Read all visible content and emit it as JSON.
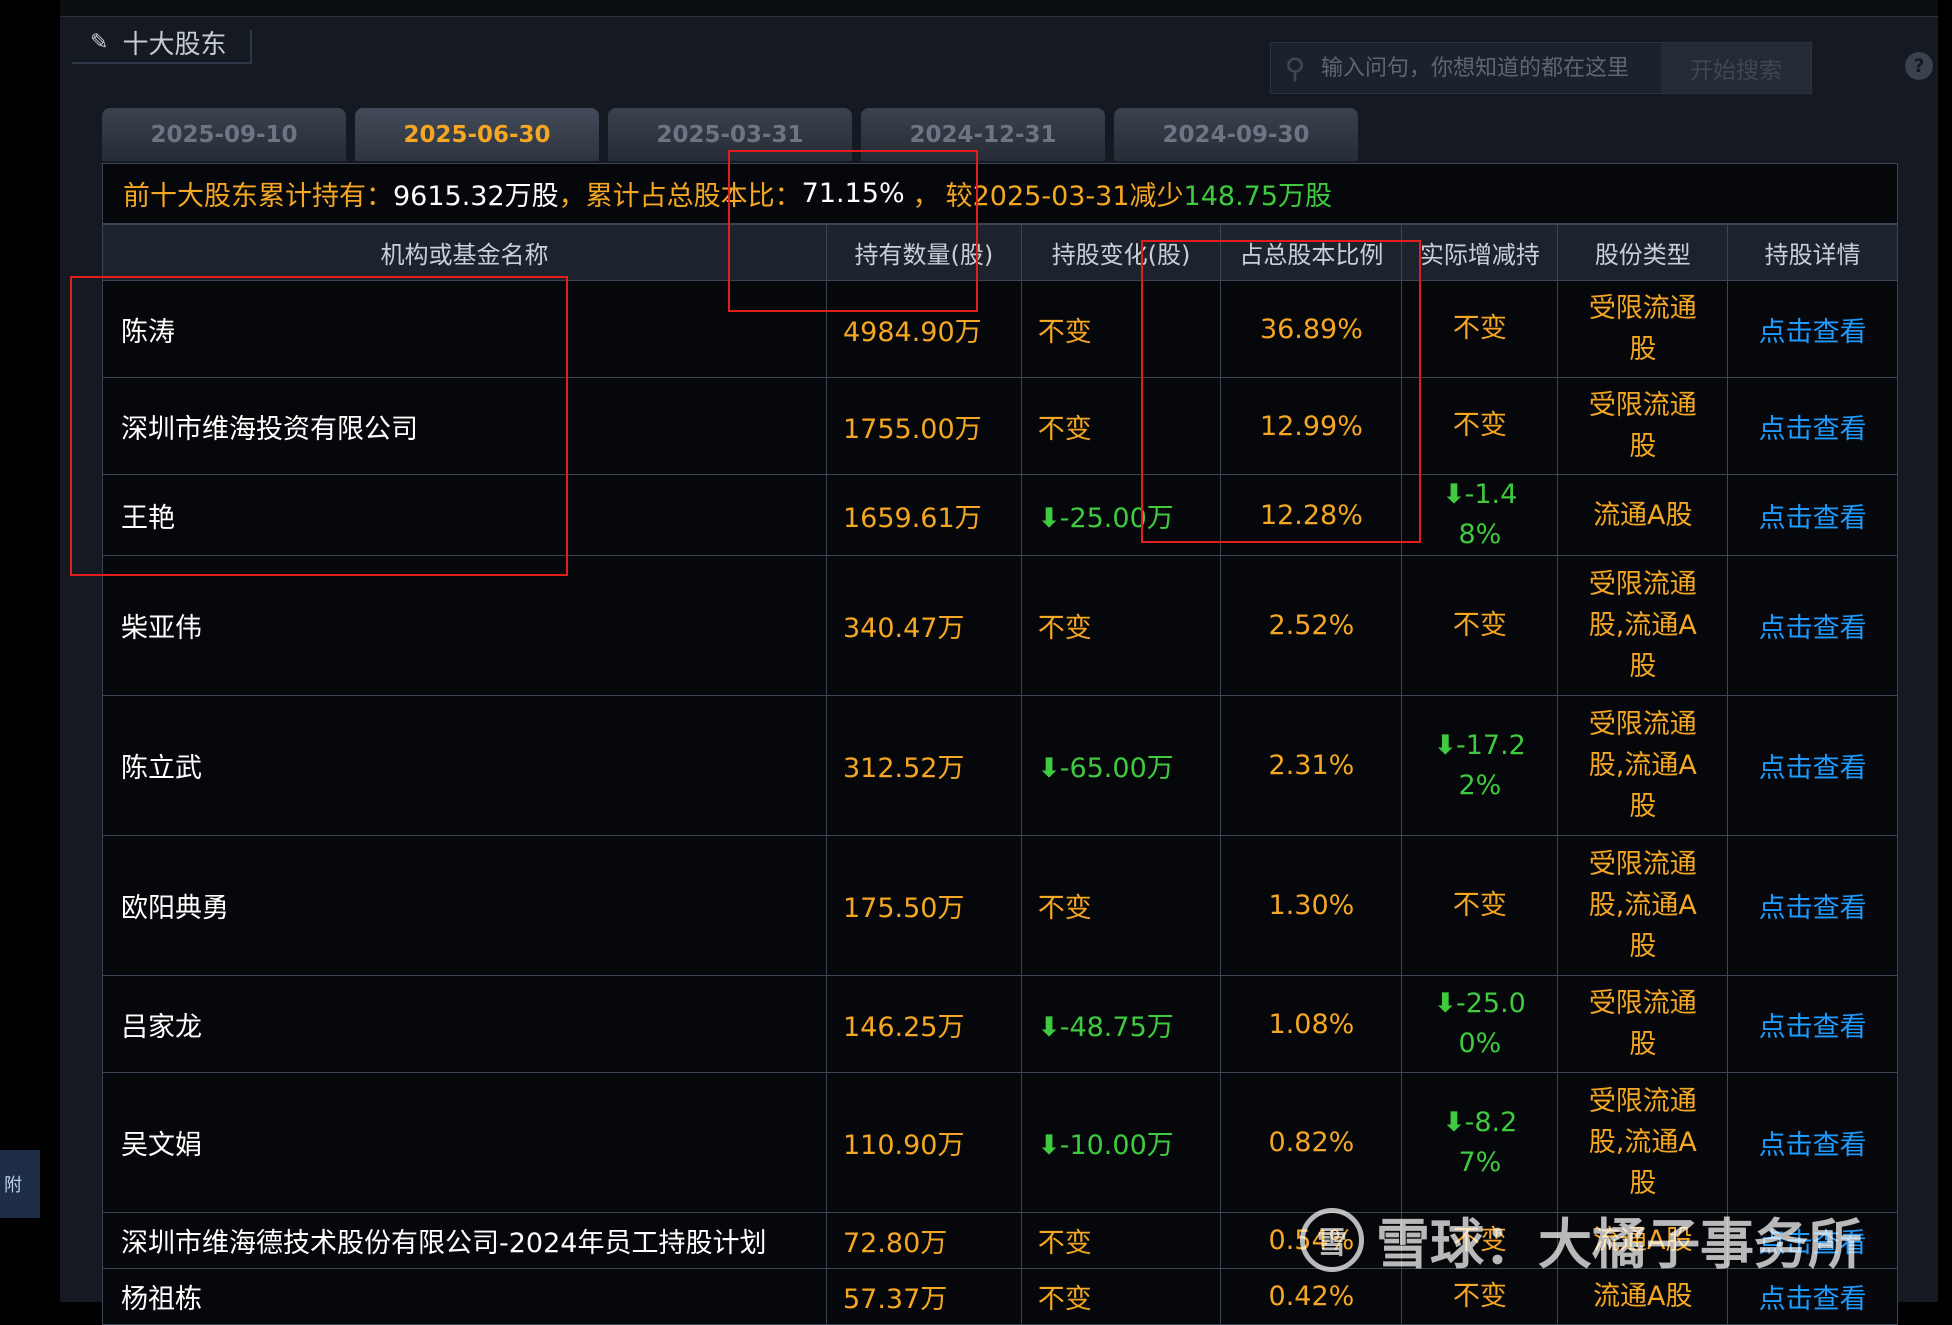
{
  "header": {
    "section_title": "十大股东",
    "search_placeholder": "输入问句，你想知道的都在这里",
    "search_button": "开始搜索",
    "help_icon": "?"
  },
  "tabs": [
    {
      "label": "2025-09-10",
      "active": false
    },
    {
      "label": "2025-06-30",
      "active": true
    },
    {
      "label": "2025-03-31",
      "active": false
    },
    {
      "label": "2024-12-31",
      "active": false
    },
    {
      "label": "2024-09-30",
      "active": false
    }
  ],
  "summary": {
    "prefix": "前十大股东累计持有：",
    "total": "9615.32万股",
    "ratio_label": "，累计占总股本比：",
    "ratio": "71.15%",
    "compare_sep": "，",
    "compare_label": "较2025-03-31减少",
    "compare_value": "148.75万股"
  },
  "columns": [
    "机构或基金名称",
    "持有数量(股)",
    "持股变化(股)",
    "占总股本比例",
    "实际增减持",
    "股份类型",
    "持股详情"
  ],
  "rows": [
    {
      "name": "陈涛",
      "hold": "4984.90万",
      "change": "不变",
      "change_dir": "same",
      "pct": "36.89%",
      "actual": "不变",
      "actual_dir": "same",
      "type": "受限流通股",
      "detail": "点击查看"
    },
    {
      "name": "深圳市维海投资有限公司",
      "hold": "1755.00万",
      "change": "不变",
      "change_dir": "same",
      "pct": "12.99%",
      "actual": "不变",
      "actual_dir": "same",
      "type": "受限流通股",
      "detail": "点击查看"
    },
    {
      "name": "王艳",
      "hold": "1659.61万",
      "change": "-25.00万",
      "change_dir": "down",
      "pct": "12.28%",
      "actual": "-1.48%",
      "actual_dir": "down",
      "type": "流通A股",
      "detail": "点击查看"
    },
    {
      "name": "柴亚伟",
      "hold": "340.47万",
      "change": "不变",
      "change_dir": "same",
      "pct": "2.52%",
      "actual": "不变",
      "actual_dir": "same",
      "type": "受限流通股,流通A股",
      "detail": "点击查看"
    },
    {
      "name": "陈立武",
      "hold": "312.52万",
      "change": "-65.00万",
      "change_dir": "down",
      "pct": "2.31%",
      "actual": "-17.22%",
      "actual_dir": "down",
      "type": "受限流通股,流通A股",
      "detail": "点击查看"
    },
    {
      "name": "欧阳典勇",
      "hold": "175.50万",
      "change": "不变",
      "change_dir": "same",
      "pct": "1.30%",
      "actual": "不变",
      "actual_dir": "same",
      "type": "受限流通股,流通A股",
      "detail": "点击查看"
    },
    {
      "name": "吕家龙",
      "hold": "146.25万",
      "change": "-48.75万",
      "change_dir": "down",
      "pct": "1.08%",
      "actual": "-25.00%",
      "actual_dir": "down",
      "type": "受限流通股",
      "detail": "点击查看"
    },
    {
      "name": "吴文娟",
      "hold": "110.90万",
      "change": "-10.00万",
      "change_dir": "down",
      "pct": "0.82%",
      "actual": "-8.27%",
      "actual_dir": "down",
      "type": "受限流通股,流通A股",
      "detail": "点击查看"
    },
    {
      "name": "深圳市维海德技术股份有限公司-2024年员工持股计划",
      "hold": "72.80万",
      "change": "不变",
      "change_dir": "same",
      "pct": "0.54%",
      "actual": "不变",
      "actual_dir": "same",
      "type": "流通A股",
      "detail": "点击查看"
    },
    {
      "name": "杨祖栋",
      "hold": "57.37万",
      "change": "不变",
      "change_dir": "same",
      "pct": "0.42%",
      "actual": "不变",
      "actual_dir": "same",
      "type": "流通A股",
      "detail": "点击查看"
    }
  ],
  "side_tab": "附",
  "watermark": {
    "logo": "雪",
    "text": "雪球：大橘子事务所"
  },
  "colors": {
    "accent": "#f5a623",
    "down": "#3fca3f",
    "link": "#1e9bff",
    "highlight": "#e11d1d"
  }
}
